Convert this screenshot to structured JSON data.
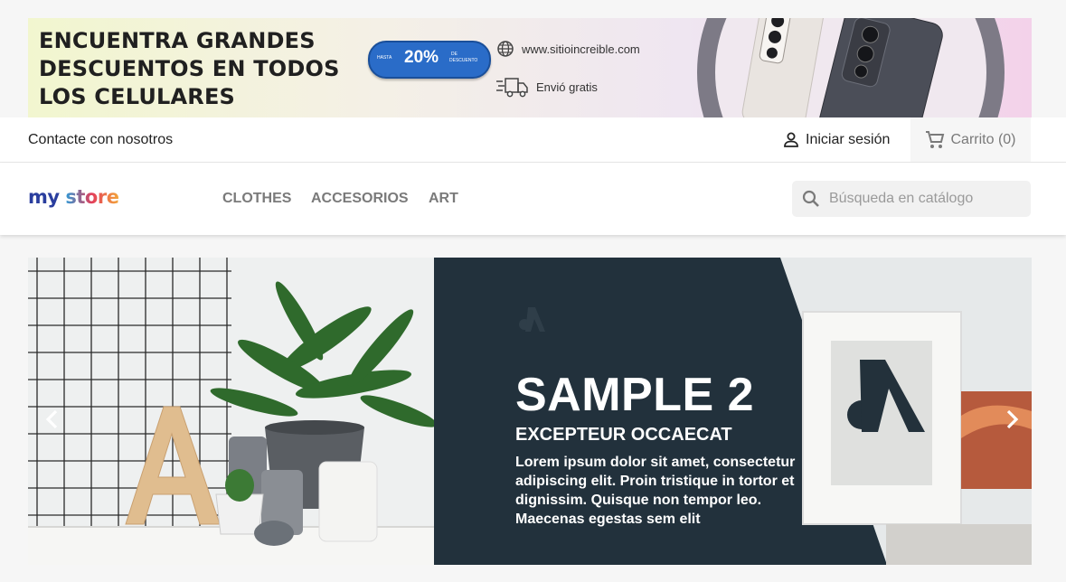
{
  "promo": {
    "headline": "ENCUENTRA GRANDES DESCUENTOS EN TODOS LOS CELULARES",
    "pill_prefix": "HASTA",
    "pill_value": "20%",
    "pill_suffix_1": "DE",
    "pill_suffix_2": "DESCUENTO",
    "site": "www.sitioincreible.com",
    "shipping": "Envió gratis"
  },
  "nav": {
    "contact": "Contacte con nosotros",
    "signin": "Iniciar sesión",
    "cart": "Carrito (0)"
  },
  "header": {
    "logo_my": "my",
    "logo_store": "store",
    "menu": [
      "CLOTHES",
      "ACCESORIOS",
      "ART"
    ],
    "search_placeholder": "Búsqueda en catálogo"
  },
  "carousel": {
    "title": "SAMPLE 2",
    "subtitle": "EXCEPTEUR OCCAECAT",
    "text": "Lorem ipsum dolor sit amet, consectetur adipiscing elit. Proin tristique in tortor et dignissim. Quisque non tempor leo. Maecenas egestas sem elit",
    "watermark_letter": "A"
  },
  "colors": {
    "accent_blue": "#2a6cc8",
    "slide_dark": "#22313c",
    "menu_gray": "#7a7a7a"
  }
}
